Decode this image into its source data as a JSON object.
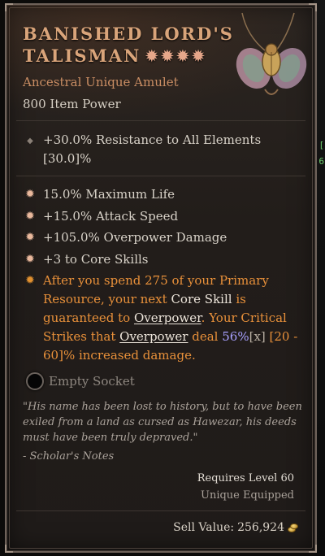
{
  "item": {
    "name_line1": "BANISHED LORD'S",
    "name_line2": "TALISMAN",
    "stars": "✹✹✹✹",
    "type": "Ancestral Unique Amulet",
    "power": "800 Item Power",
    "image_icon": "beetle-amulet-icon"
  },
  "implicit": {
    "text": "+30.0% Resistance to All Elements [30.0]%"
  },
  "affixes": [
    {
      "text": "15.0% Maximum Life"
    },
    {
      "text": "+15.0% Attack Speed"
    },
    {
      "text": "+105.0% Overpower Damage"
    },
    {
      "text": "+3 to Core Skills"
    }
  ],
  "unique_power": {
    "p1": "After you spend 275 of your Primary Resource, your next ",
    "core": "Core",
    "p2": " ",
    "skill": "Skill",
    "p3": " is guaranteed to ",
    "overpower1": "Overpower",
    "p4": ". Your Critical Strikes that ",
    "overpower2": "Overpower",
    "p5": " deal ",
    "roll": "56%",
    "bracket": "[x]",
    "p6": " [20 - 60]% increased damage."
  },
  "socket": {
    "label": "Empty Socket"
  },
  "flavor": {
    "quote": "\"His name has been lost to history, but to have been exiled from a land as cursed as Hawezar, his deeds must have been truly depraved.\"",
    "source": "- Scholar's Notes"
  },
  "requirements": {
    "level": "Requires Level 60",
    "equipped": "Unique Equipped"
  },
  "sell": {
    "label": "Sell Value:",
    "value": "256,924",
    "icon": "gold-coins-icon"
  },
  "edge_glyphs": [
    "[",
    "6"
  ],
  "colors": {
    "title": "#d9a47a",
    "unique_text": "#e8903a",
    "roll_value": "#a8a0ff",
    "frame": "#6e625a"
  }
}
